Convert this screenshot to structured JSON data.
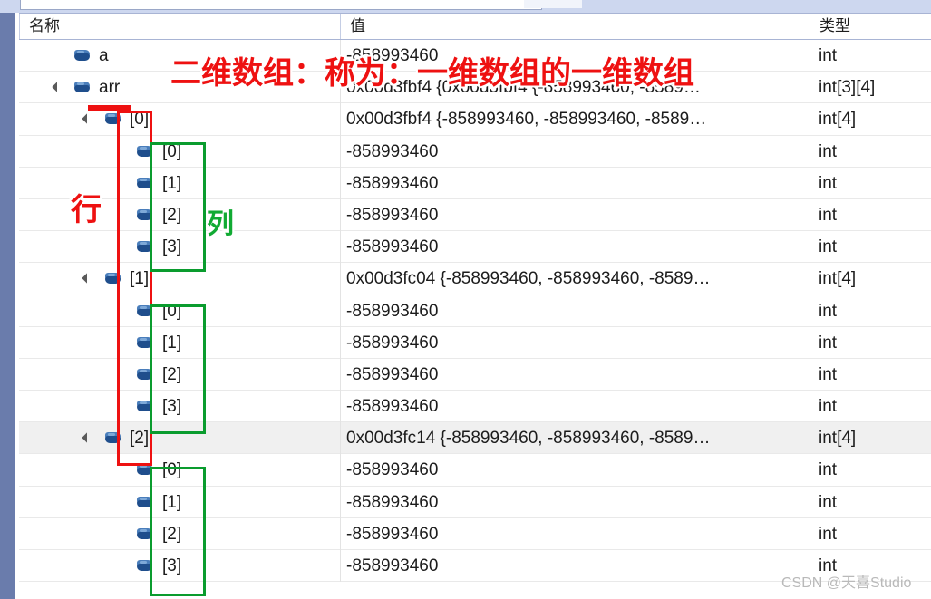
{
  "window": {
    "toolbar": {
      "search_value": ""
    },
    "columns": [
      {
        "key": "name",
        "label": "名称"
      },
      {
        "key": "value",
        "label": "值"
      },
      {
        "key": "type",
        "label": "类型"
      }
    ]
  },
  "rows": [
    {
      "level": 1,
      "expander": "none",
      "name": "a",
      "value": "-858993460",
      "type": "int",
      "selected": false
    },
    {
      "level": 1,
      "expander": "expanded",
      "name": "arr",
      "value": "0x00d3fbf4 {0x00d3fbf4 {-858993460, -8589…",
      "type": "int[3][4]",
      "selected": false
    },
    {
      "level": 2,
      "expander": "expanded",
      "name": "[0]",
      "value": "0x00d3fbf4 {-858993460, -858993460, -8589…",
      "type": "int[4]",
      "selected": false
    },
    {
      "level": 3,
      "expander": "none",
      "name": "[0]",
      "value": "-858993460",
      "type": "int",
      "selected": false
    },
    {
      "level": 3,
      "expander": "none",
      "name": "[1]",
      "value": "-858993460",
      "type": "int",
      "selected": false
    },
    {
      "level": 3,
      "expander": "none",
      "name": "[2]",
      "value": "-858993460",
      "type": "int",
      "selected": false
    },
    {
      "level": 3,
      "expander": "none",
      "name": "[3]",
      "value": "-858993460",
      "type": "int",
      "selected": false
    },
    {
      "level": 2,
      "expander": "expanded",
      "name": "[1]",
      "value": "0x00d3fc04 {-858993460, -858993460, -8589…",
      "type": "int[4]",
      "selected": false
    },
    {
      "level": 3,
      "expander": "none",
      "name": "[0]",
      "value": "-858993460",
      "type": "int",
      "selected": false
    },
    {
      "level": 3,
      "expander": "none",
      "name": "[1]",
      "value": "-858993460",
      "type": "int",
      "selected": false
    },
    {
      "level": 3,
      "expander": "none",
      "name": "[2]",
      "value": "-858993460",
      "type": "int",
      "selected": false
    },
    {
      "level": 3,
      "expander": "none",
      "name": "[3]",
      "value": "-858993460",
      "type": "int",
      "selected": false
    },
    {
      "level": 2,
      "expander": "expanded",
      "name": "[2]",
      "value": "0x00d3fc14 {-858993460, -858993460, -8589…",
      "type": "int[4]",
      "selected": true
    },
    {
      "level": 3,
      "expander": "none",
      "name": "[0]",
      "value": "-858993460",
      "type": "int",
      "selected": false
    },
    {
      "level": 3,
      "expander": "none",
      "name": "[1]",
      "value": "-858993460",
      "type": "int",
      "selected": false
    },
    {
      "level": 3,
      "expander": "none",
      "name": "[2]",
      "value": "-858993460",
      "type": "int",
      "selected": false
    },
    {
      "level": 3,
      "expander": "none",
      "name": "[3]",
      "value": "-858993460",
      "type": "int",
      "selected": false
    }
  ],
  "annotations": {
    "title_note": "二维数组：称为：一维数组的一维数组",
    "row_label": "行",
    "col_label": "列",
    "colors": {
      "red": "#ee1111",
      "green": "#0a9c2e"
    }
  },
  "watermark": {
    "text": "CSDN @天喜Studio"
  }
}
